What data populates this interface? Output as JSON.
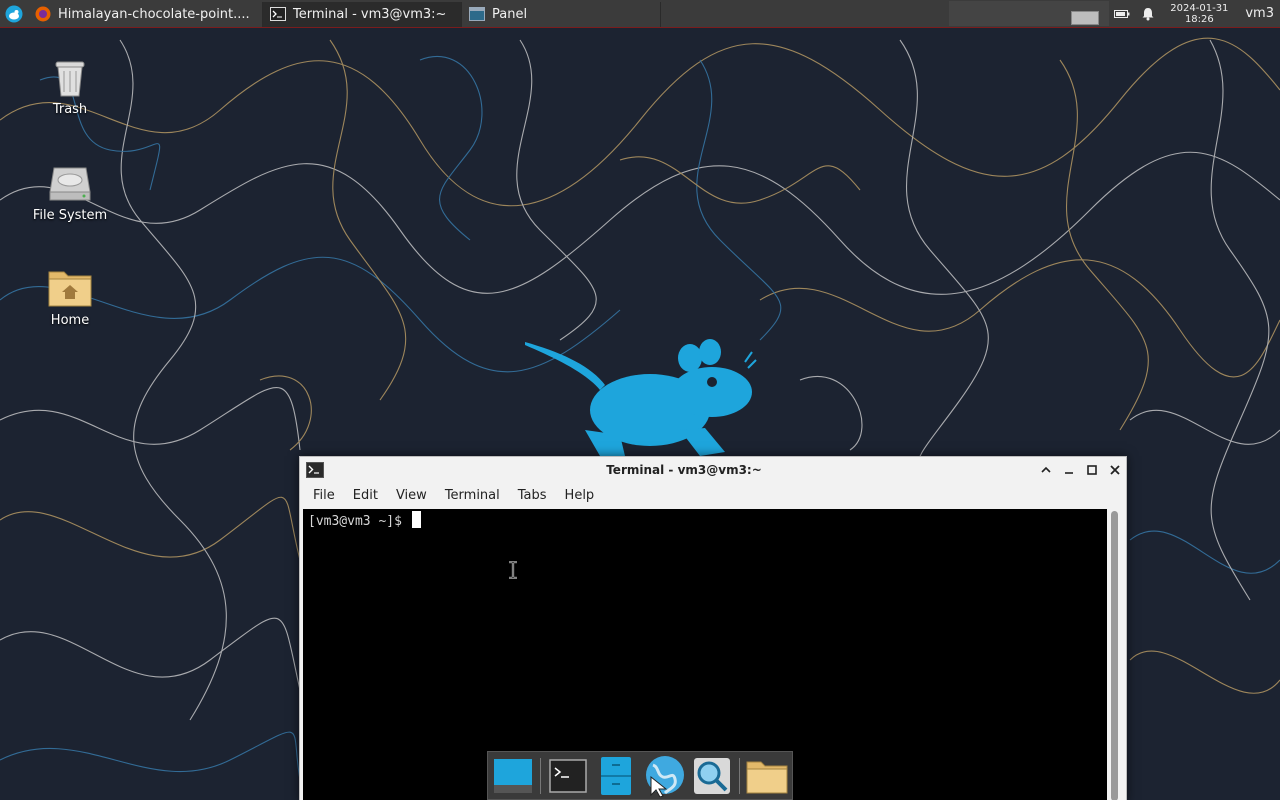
{
  "panel": {
    "app_menu_icon": "xfce-mouse-icon",
    "tasks": [
      {
        "label": "Himalayan-chocolate-point....",
        "icon": "firefox-icon",
        "active": false
      },
      {
        "label": "Terminal - vm3@vm3:~",
        "icon": "terminal-icon",
        "active": true
      },
      {
        "label": "Panel",
        "icon": "panel-icon",
        "active": false
      }
    ],
    "clock": {
      "date": "2024-01-31",
      "time": "18:26"
    },
    "user": "vm3"
  },
  "desktop_icons": [
    {
      "label": "Trash",
      "icon": "trash-icon"
    },
    {
      "label": "File System",
      "icon": "drive-icon"
    },
    {
      "label": "Home",
      "icon": "home-folder-icon"
    }
  ],
  "terminal": {
    "title": "Terminal - vm3@vm3:~",
    "menu": [
      "File",
      "Edit",
      "View",
      "Terminal",
      "Tabs",
      "Help"
    ],
    "prompt": "[vm3@vm3 ~]$ "
  },
  "dock": [
    "show-desktop-icon",
    "terminal-icon",
    "file-manager-icon",
    "web-browser-icon",
    "app-finder-icon",
    "folder-icon"
  ],
  "colors": {
    "accent": "#1ea5dc",
    "panel": "#3b3b3b",
    "wallpaper": "#1c2331"
  }
}
